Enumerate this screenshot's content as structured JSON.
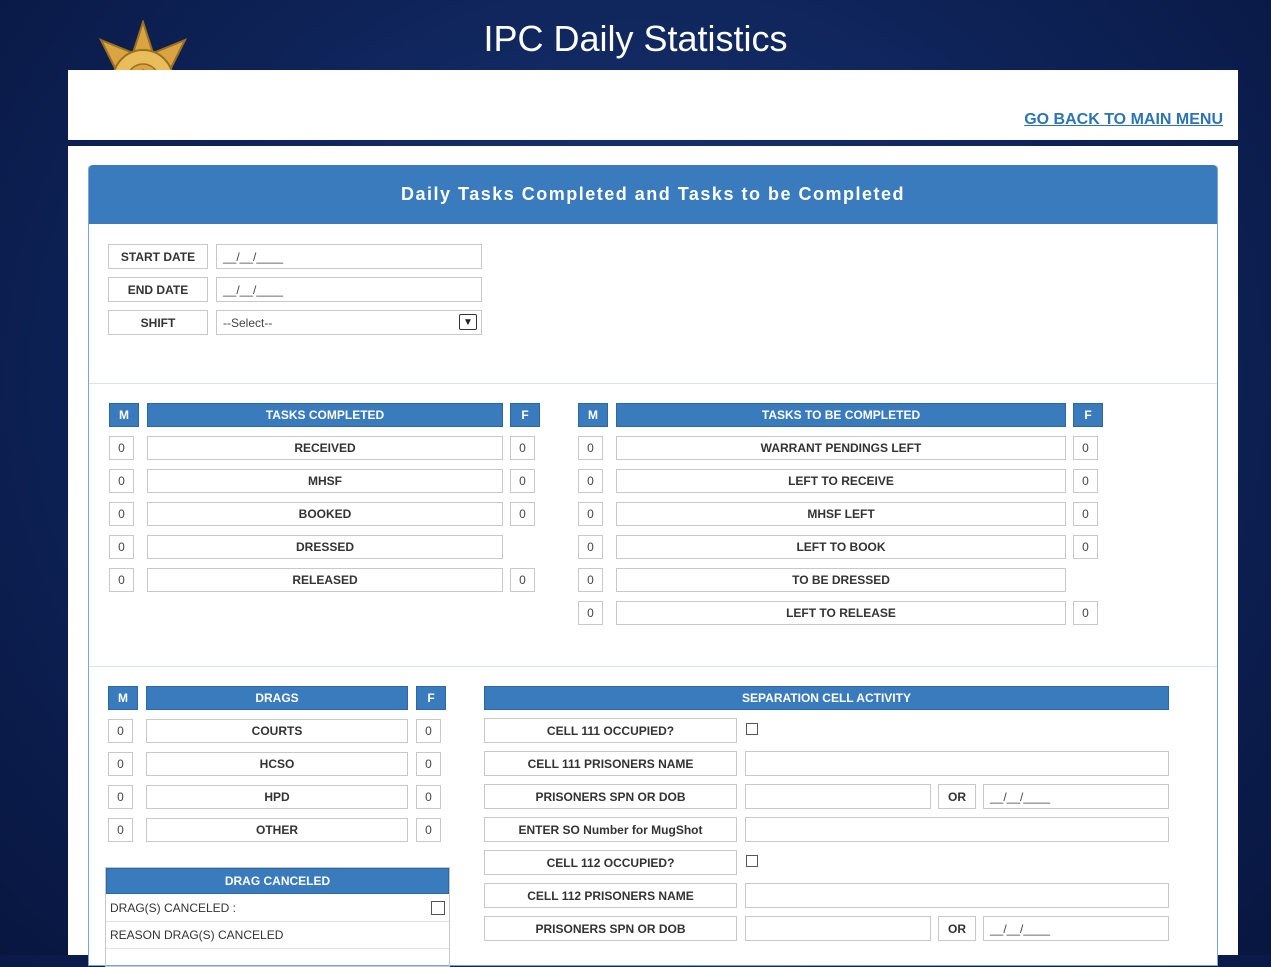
{
  "title": "IPC Daily Statistics",
  "back_link": "GO BACK TO MAIN MENU",
  "panel_title": "Daily Tasks Completed and Tasks to be Completed",
  "filters": {
    "start_label": "START DATE",
    "start_value": "__/__/____",
    "end_label": "END DATE",
    "end_value": "__/__/____",
    "shift_label": "SHIFT",
    "shift_value": "--Select--"
  },
  "cols": {
    "m": "M",
    "f": "F"
  },
  "completed": {
    "header": "TASKS COMPLETED",
    "rows": [
      {
        "label": "RECEIVED",
        "m": "0",
        "f": "0"
      },
      {
        "label": "MHSF",
        "m": "0",
        "f": "0"
      },
      {
        "label": "BOOKED",
        "m": "0",
        "f": "0"
      },
      {
        "label": "DRESSED",
        "m": "0",
        "f": ""
      },
      {
        "label": "RELEASED",
        "m": "0",
        "f": "0"
      }
    ]
  },
  "todo": {
    "header": "TASKS TO BE COMPLETED",
    "rows": [
      {
        "label": "WARRANT PENDINGS LEFT",
        "m": "0",
        "f": "0"
      },
      {
        "label": "LEFT TO RECEIVE",
        "m": "0",
        "f": "0"
      },
      {
        "label": "MHSF LEFT",
        "m": "0",
        "f": "0"
      },
      {
        "label": "LEFT TO BOOK",
        "m": "0",
        "f": "0"
      },
      {
        "label": "TO BE DRESSED",
        "m": "0",
        "f": ""
      },
      {
        "label": "LEFT TO RELEASE",
        "m": "0",
        "f": "0"
      }
    ]
  },
  "drags": {
    "header": "DRAGS",
    "rows": [
      {
        "label": "COURTS",
        "m": "0",
        "f": "0"
      },
      {
        "label": "HCSO",
        "m": "0",
        "f": "0"
      },
      {
        "label": "HPD",
        "m": "0",
        "f": "0"
      },
      {
        "label": "OTHER",
        "m": "0",
        "f": "0"
      }
    ]
  },
  "drag_canceled": {
    "header": "DRAG CANCELED",
    "row1": "DRAG(S) CANCELED :",
    "row2": "REASON DRAG(S) CANCELED"
  },
  "separation": {
    "header": "SEPARATION CELL ACTIVITY",
    "cell111_occupied": "CELL 111 OCCUPIED?",
    "cell111_name": "CELL 111 PRISONERS NAME",
    "spn1": "PRISONERS SPN OR DOB",
    "or": "OR",
    "date_mask": "__/__/____",
    "so_number": "ENTER SO Number for MugShot",
    "cell112_occupied": "CELL 112 OCCUPIED?",
    "cell112_name": "CELL 112 PRISONERS NAME",
    "spn2": "PRISONERS SPN OR DOB"
  },
  "colors": {
    "header_blue": "#3a7bbd",
    "link_blue": "#2e74b5"
  }
}
